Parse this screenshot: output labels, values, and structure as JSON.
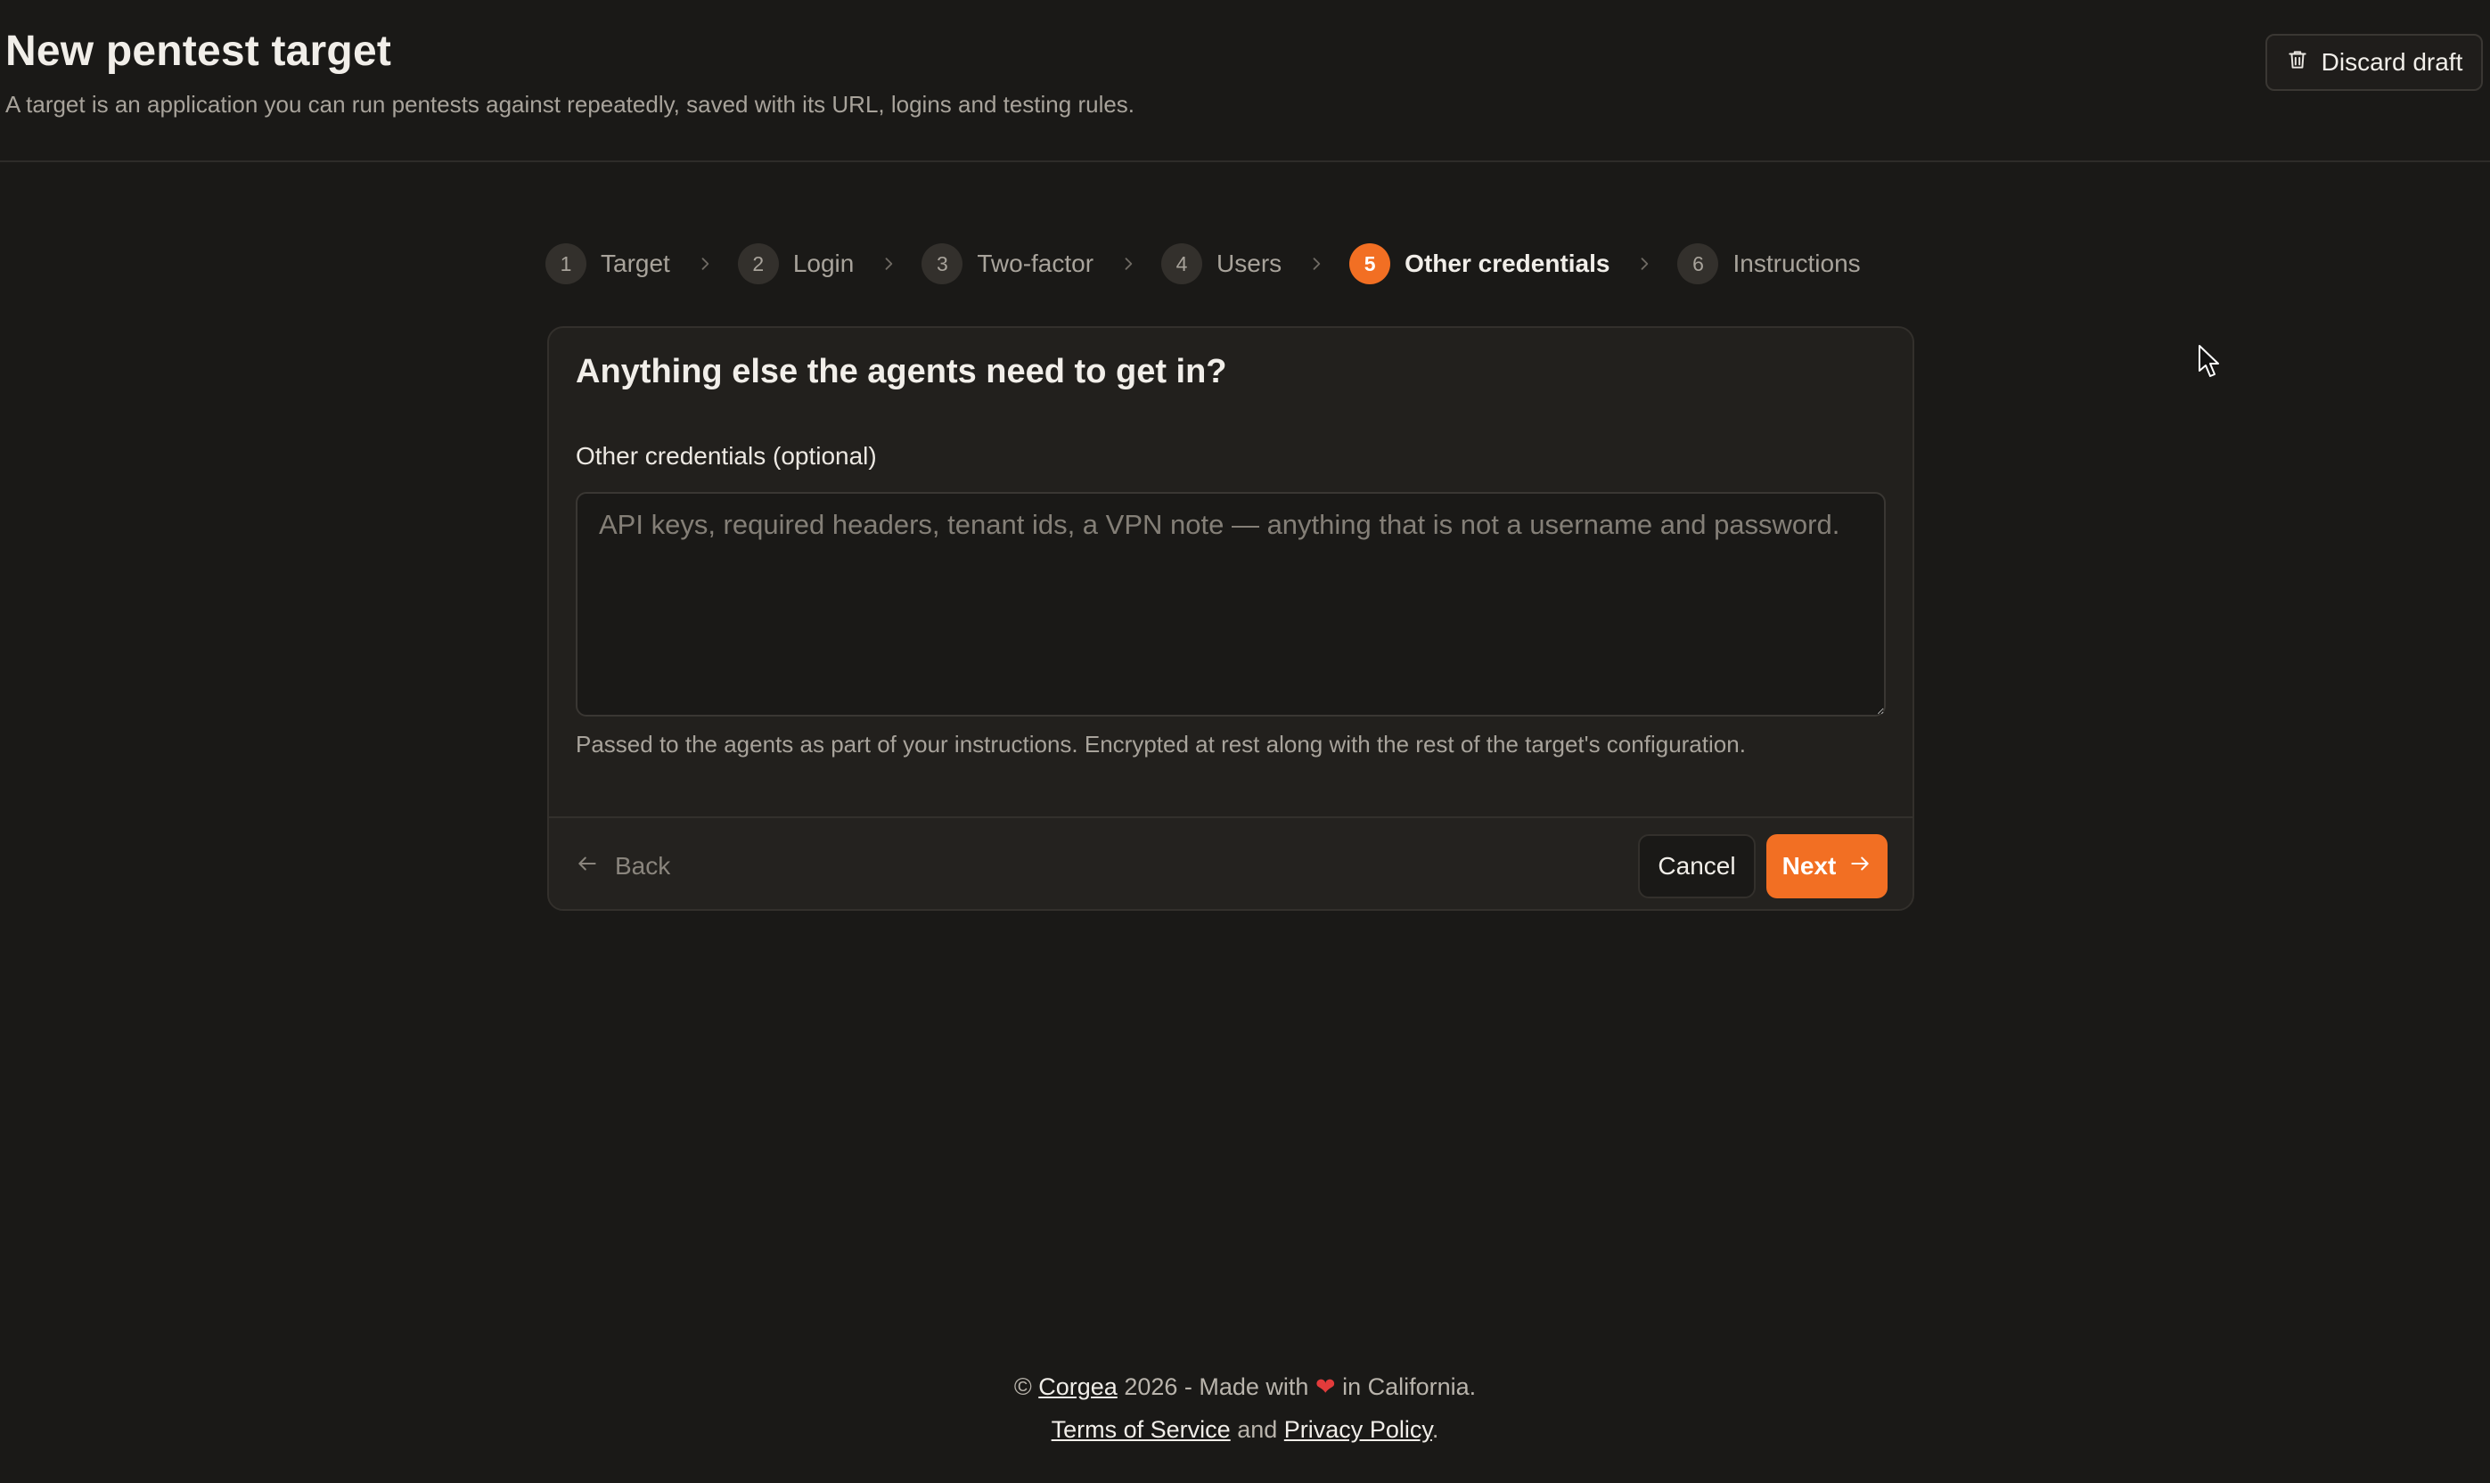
{
  "header": {
    "title": "New pentest target",
    "subtitle": "A target is an application you can run pentests against repeatedly, saved with its URL, logins and testing rules.",
    "discard_label": "Discard draft"
  },
  "stepper": {
    "steps": [
      {
        "num": "1",
        "label": "Target"
      },
      {
        "num": "2",
        "label": "Login"
      },
      {
        "num": "3",
        "label": "Two-factor"
      },
      {
        "num": "4",
        "label": "Users"
      },
      {
        "num": "5",
        "label": "Other credentials"
      },
      {
        "num": "6",
        "label": "Instructions"
      }
    ],
    "active_step": 5
  },
  "card": {
    "title": "Anything else the agents need to get in?",
    "field_label": "Other credentials (optional)",
    "field_value": "",
    "field_placeholder": "API keys, required headers, tenant ids, a VPN note — anything that is not a username and password.",
    "help_text": "Passed to the agents as part of your instructions. Encrypted at rest along with the rest of the target's configuration.",
    "back_label": "Back",
    "cancel_label": "Cancel",
    "next_label": "Next"
  },
  "footer": {
    "copyright_symbol": "©",
    "company": "Corgea",
    "made_with_prefix": "2026 - Made with",
    "heart": "❤",
    "made_with_suffix": "in California.",
    "terms_label": "Terms of Service",
    "and_text": "and",
    "privacy_label": "Privacy Policy",
    "period": "."
  },
  "colors": {
    "background": "#1a1917",
    "card": "#22201d",
    "accent": "#f26f23",
    "text": "#f1eee9",
    "muted": "#a8a39b"
  },
  "icons": {
    "discard": "trash-icon",
    "step_separator": "chevron-right-icon",
    "back": "arrow-left-icon",
    "next": "arrow-right-icon",
    "cursor": "mouse-pointer-icon"
  }
}
